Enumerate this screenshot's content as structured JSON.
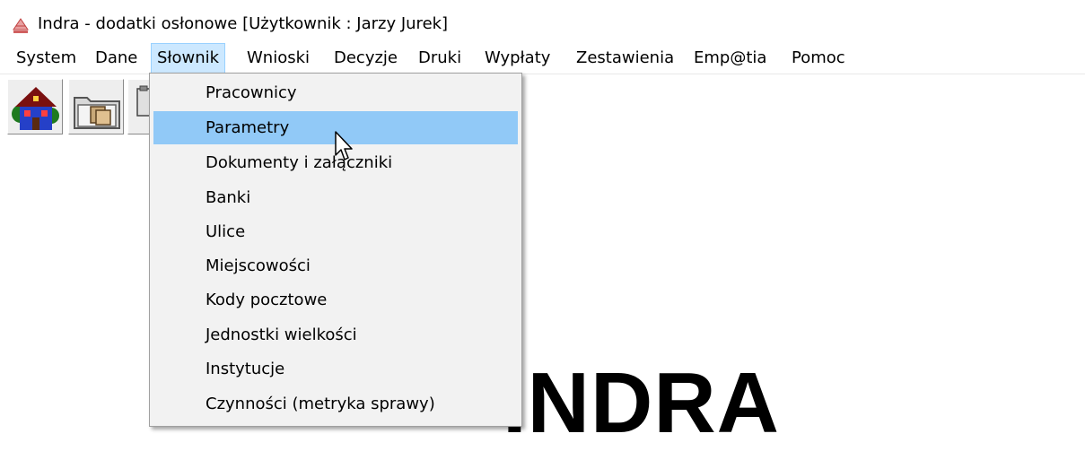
{
  "window": {
    "title": "Indra - dodatki osłonowe  [Użytkownik : Jarzy Jurek]",
    "icon": "indra-app-icon"
  },
  "menubar": {
    "items": [
      {
        "label": "System"
      },
      {
        "label": "Dane"
      },
      {
        "label": "Słownik",
        "active": true
      },
      {
        "label": "Wnioski"
      },
      {
        "label": "Decyzje"
      },
      {
        "label": "Druki"
      },
      {
        "label": "Wypłaty"
      },
      {
        "label": "Zestawienia"
      },
      {
        "label": "Emp@tia"
      },
      {
        "label": "Pomoc"
      }
    ]
  },
  "toolbar": {
    "buttons": [
      {
        "icon": "house-icon"
      },
      {
        "icon": "folder-documents-icon"
      },
      {
        "icon": "clipboard-icon"
      }
    ]
  },
  "dropdown": {
    "items": [
      {
        "label": "Pracownicy"
      },
      {
        "label": "Parametry",
        "highlighted": true
      },
      {
        "label": "Dokumenty i załączniki"
      },
      {
        "label": "Banki"
      },
      {
        "label": "Ulice"
      },
      {
        "label": "Miejscowości"
      },
      {
        "label": "Kody pocztowe"
      },
      {
        "label": "Jednostki wielkości"
      },
      {
        "label": "Instytucje"
      },
      {
        "label": "Czynności (metryka sprawy)"
      }
    ]
  },
  "logo": {
    "text": "INDRA"
  },
  "colors": {
    "menu_active_bg": "#cce8ff",
    "dropdown_highlight": "#91c9f7",
    "dropdown_bg": "#f2f2f2"
  }
}
